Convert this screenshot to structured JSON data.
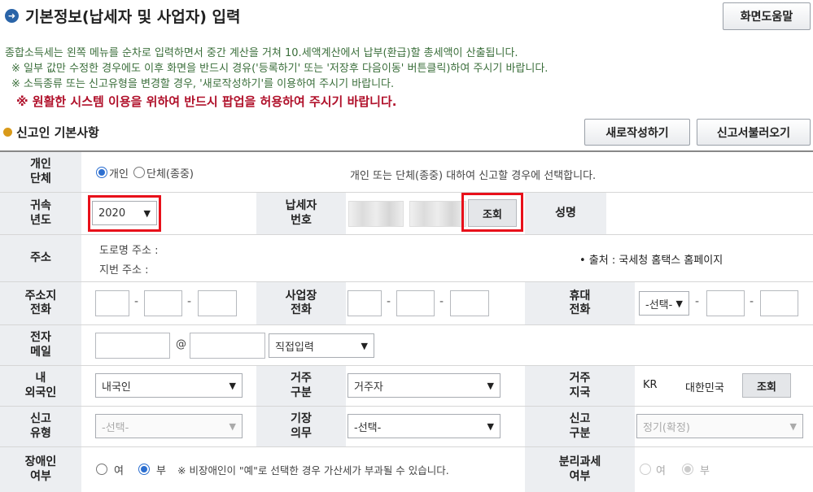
{
  "header": {
    "title": "기본정보(납세자 및 사업자) 입력",
    "help_button": "화면도움말"
  },
  "notices": {
    "line1": "종합소득세는 왼쪽 메뉴를 순차로 입력하면서 중간 계산을 거쳐 10.세액계산에서 납부(환급)할 총세액이 산출됩니다.",
    "line2": "※ 일부 값만 수정한 경우에도 이후 화면을 반드시 경유('등록하기' 또는 '저장후 다음이동' 버튼클릭)하여 주시기 바랍니다.",
    "line3": "※ 소득종류 또는 신고유형을 변경할 경우, '새로작성하기'를 이용하여 주시기 바랍니다.",
    "warning": "※ 원활한 시스템 이용을 위하여 반드시 팝업을 허용하여 주시기 바랍니다."
  },
  "section": {
    "title": "신고인 기본사항",
    "new_button": "새로작성하기",
    "load_button": "신고서불러오기"
  },
  "form": {
    "type": {
      "label": "개인\n단체",
      "opt_individual": "개인",
      "opt_group": "단체(종중)",
      "hint": "개인 또는 단체(종중) 대하여 신고할 경우에 선택합니다."
    },
    "year": {
      "label": "귀속\n년도",
      "value": "2020"
    },
    "taxpayer_no": {
      "label": "납세자\n번호",
      "lookup": "조회"
    },
    "name": {
      "label": "성명"
    },
    "address": {
      "label": "주소",
      "road": "도로명 주소 :",
      "lot": "지번 주소 :"
    },
    "source_note": "• 출처 : 국세청 홈택스 홈페이지",
    "home_phone": {
      "label": "주소지\n전화"
    },
    "biz_phone": {
      "label": "사업장\n전화"
    },
    "mobile": {
      "label": "휴대\n전화",
      "select": "-선택-"
    },
    "email": {
      "label": "전자\n메일",
      "at": "@",
      "domain_select": "직접입력"
    },
    "nationality": {
      "label": "내\n외국인",
      "value": "내국인"
    },
    "residency": {
      "label": "거주\n구분",
      "value": "거주자"
    },
    "country": {
      "label": "거주\n지국",
      "code": "KR",
      "name": "대한민국",
      "lookup": "조회"
    },
    "report_type": {
      "label": "신고\n유형",
      "value": "-선택-"
    },
    "bookkeeping": {
      "label": "기장\n의무",
      "value": "-선택-"
    },
    "report_class": {
      "label": "신고\n구분",
      "value": "정기(확정)"
    },
    "disabled": {
      "label": "장애인\n여부",
      "yes": "여",
      "no": "부",
      "note": "※ 비장애인이 \"예\"로 선택한 경우 가산세가 부과될 수 있습니다."
    },
    "separate_tax": {
      "label": "분리과세\n여부",
      "yes": "여",
      "no": "부"
    }
  }
}
